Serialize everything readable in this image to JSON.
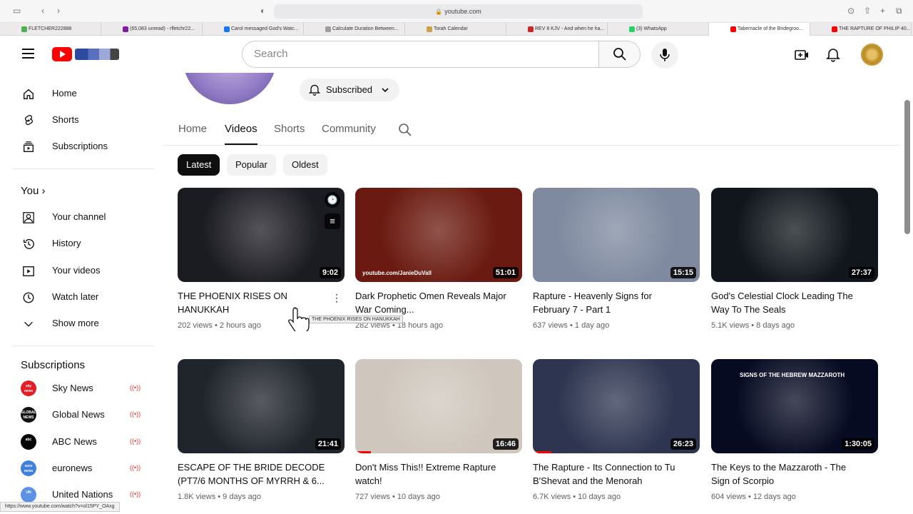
{
  "browser": {
    "url": "youtube.com",
    "tabs": [
      {
        "title": "FLETCHER222888",
        "color": "#4caf50"
      },
      {
        "title": "(65,083 unread) - rfletchr22...",
        "color": "#7b1fa2"
      },
      {
        "title": "Carol messaged God's Watc...",
        "color": "#1877f2"
      },
      {
        "title": "Calculate Duration Between...",
        "color": "#9e9e9e"
      },
      {
        "title": "Torah Calendar",
        "color": "#c8a24a"
      },
      {
        "title": "REV 8 KJV - And when he ha...",
        "color": "#c62828"
      },
      {
        "title": "(3) WhatsApp",
        "color": "#25d366"
      },
      {
        "title": "Tabernacle of the Bridegroo...",
        "color": "#ff0000"
      },
      {
        "title": "THE RAPTURE OF PHILIP 40...",
        "color": "#ff0000"
      }
    ],
    "status_url": "https://www.youtube.com/watch?v=ol15PY_OAxg"
  },
  "header": {
    "search_placeholder": "Search"
  },
  "sidebar": {
    "main_items": [
      {
        "label": "Home",
        "icon": "home-icon"
      },
      {
        "label": "Shorts",
        "icon": "shorts-icon"
      },
      {
        "label": "Subscriptions",
        "icon": "subscriptions-icon"
      }
    ],
    "you_heading": "You",
    "you_items": [
      {
        "label": "Your channel",
        "icon": "channel-icon"
      },
      {
        "label": "History",
        "icon": "history-icon"
      },
      {
        "label": "Your videos",
        "icon": "videos-icon"
      },
      {
        "label": "Watch later",
        "icon": "clock-icon"
      },
      {
        "label": "Show more",
        "icon": "chevron-down-icon"
      }
    ],
    "subscriptions_heading": "Subscriptions",
    "subscriptions": [
      {
        "label": "Sky News",
        "avatar_text": "sky news",
        "color": "#e41e26"
      },
      {
        "label": "Global News",
        "avatar_text": "GLOBAL NEWS",
        "color": "#111111"
      },
      {
        "label": "ABC News",
        "avatar_text": "abc",
        "color": "#000000"
      },
      {
        "label": "euronews",
        "avatar_text": "euro news",
        "color": "#3f7fe0"
      },
      {
        "label": "United Nations",
        "avatar_text": "UN",
        "color": "#5b92e5"
      }
    ]
  },
  "channel": {
    "subscribed_label": "Subscribed",
    "tabs": [
      "Home",
      "Videos",
      "Shorts",
      "Community"
    ],
    "active_tab": "Videos",
    "chips": [
      "Latest",
      "Popular",
      "Oldest"
    ]
  },
  "videos": [
    {
      "title": "THE PHOENIX RISES ON HANUKKAH",
      "views": "202 views",
      "age": "2 hours ago",
      "duration": "9:02",
      "bg": "#1b1b22"
    },
    {
      "title": "Dark Prophetic Omen Reveals Major War Coming...",
      "views": "282 views",
      "age": "18 hours ago",
      "duration": "51:01",
      "bg": "#6a1a10",
      "caption": "youtube.com/JanieDuVall"
    },
    {
      "title": "Rapture - Heavenly Signs for February 7 - Part 1",
      "views": "637 views",
      "age": "1 day ago",
      "duration": "15:15",
      "bg": "#7f8aa0"
    },
    {
      "title": "God's Celestial Clock Leading The Way To The Seals",
      "views": "5.1K views",
      "age": "8 days ago",
      "duration": "27:37",
      "bg": "#10161c"
    },
    {
      "title": "ESCAPE OF THE BRIDE DECODE (PT7/6 MONTHS OF MYRRH & 6...",
      "views": "1.8K views",
      "age": "9 days ago",
      "duration": "21:41",
      "bg": "#20252c"
    },
    {
      "title": "Don't Miss This!! Extreme Rapture watch!",
      "views": "727 views",
      "age": "10 days ago",
      "duration": "16:46",
      "bg": "#cfc7bd"
    },
    {
      "title": "The Rapture - Its Connection to Tu B'Shevat and the Menorah",
      "views": "6.7K views",
      "age": "10 days ago",
      "duration": "26:23",
      "bg": "#2d3550"
    },
    {
      "title": "The Keys to the Mazzaroth - The Sign of Scorpio",
      "views": "604 views",
      "age": "12 days ago",
      "duration": "1:30:05",
      "bg": "#070b22",
      "caption": "SIGNS OF THE HEBREW MAZZAROTH"
    }
  ],
  "tooltip": "THE PHOENIX RISES ON HANUKKAH",
  "accent": "#ff0000"
}
